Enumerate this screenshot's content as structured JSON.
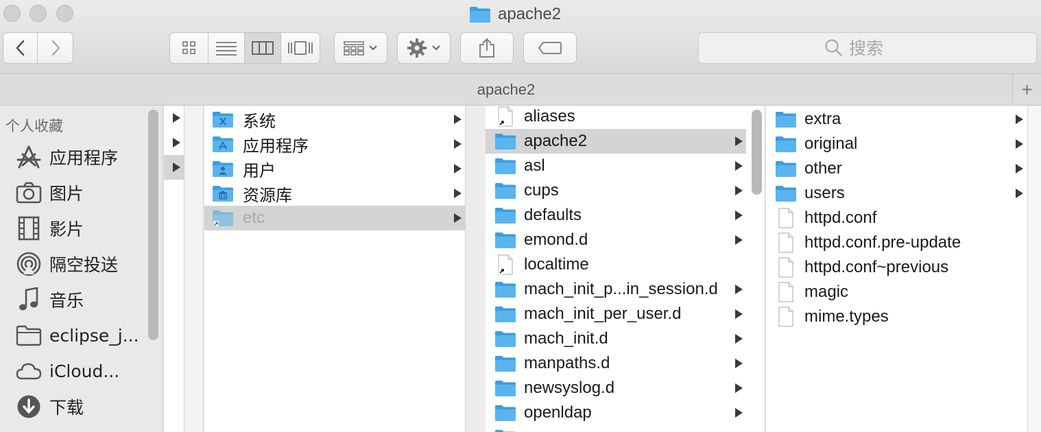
{
  "window": {
    "title": "apache2",
    "tab_title": "apache2",
    "tab_add": "+"
  },
  "toolbar": {
    "back_icon": "chevron-left-icon",
    "forward_icon": "chevron-right-icon",
    "view_modes": [
      "icon-view",
      "list-view",
      "column-view",
      "cover-flow-view"
    ],
    "active_view": "column-view",
    "search_placeholder": "搜索"
  },
  "sidebar": {
    "heading": "个人收藏",
    "items": [
      {
        "label": "应用程序",
        "icon": "applications-icon"
      },
      {
        "label": "图片",
        "icon": "camera-icon"
      },
      {
        "label": "影片",
        "icon": "film-icon"
      },
      {
        "label": "隔空投送",
        "icon": "airdrop-icon"
      },
      {
        "label": "音乐",
        "icon": "music-icon"
      },
      {
        "label": "eclipse_j...",
        "icon": "folder-icon"
      },
      {
        "label": "iCloud...",
        "icon": "cloud-icon"
      },
      {
        "label": "下载",
        "icon": "download-icon"
      }
    ]
  },
  "column1": {
    "items": [
      {},
      {},
      {
        "selected": true
      }
    ]
  },
  "column2": {
    "items": [
      {
        "label": "系统",
        "icon": "system-folder-icon"
      },
      {
        "label": "应用程序",
        "icon": "applications-folder-icon"
      },
      {
        "label": "用户",
        "icon": "users-folder-icon"
      },
      {
        "label": "资源库",
        "icon": "library-folder-icon"
      },
      {
        "label": "etc",
        "icon": "alias-folder-icon",
        "selected": true
      }
    ]
  },
  "column3": {
    "items": [
      {
        "label": "aliases",
        "type": "alias"
      },
      {
        "label": "apache2",
        "type": "folder",
        "selected": true
      },
      {
        "label": "asl",
        "type": "folder"
      },
      {
        "label": "cups",
        "type": "folder"
      },
      {
        "label": "defaults",
        "type": "folder"
      },
      {
        "label": "emond.d",
        "type": "folder"
      },
      {
        "label": "localtime",
        "type": "alias"
      },
      {
        "label": "mach_init_p...in_session.d",
        "type": "folder"
      },
      {
        "label": "mach_init_per_user.d",
        "type": "folder"
      },
      {
        "label": "mach_init.d",
        "type": "folder"
      },
      {
        "label": "manpaths.d",
        "type": "folder"
      },
      {
        "label": "newsyslog.d",
        "type": "folder"
      },
      {
        "label": "openldap",
        "type": "folder"
      }
    ]
  },
  "column4": {
    "items": [
      {
        "label": "extra",
        "type": "folder"
      },
      {
        "label": "original",
        "type": "folder"
      },
      {
        "label": "other",
        "type": "folder"
      },
      {
        "label": "users",
        "type": "folder"
      },
      {
        "label": "httpd.conf",
        "type": "file"
      },
      {
        "label": "httpd.conf.pre-update",
        "type": "file"
      },
      {
        "label": "httpd.conf~previous",
        "type": "file"
      },
      {
        "label": "magic",
        "type": "file"
      },
      {
        "label": "mime.types",
        "type": "file"
      }
    ]
  },
  "colors": {
    "folder": "#5ab4ee",
    "folder_dark": "#3b9ee0",
    "selection": "#d4d4d4"
  }
}
